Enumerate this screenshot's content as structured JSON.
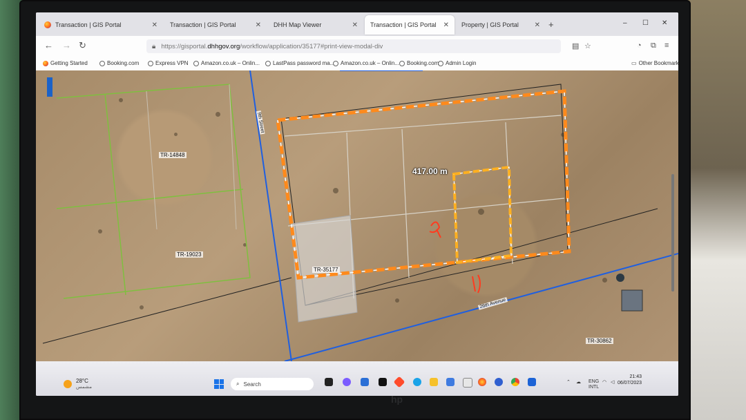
{
  "tabs": [
    {
      "title": "Transaction | GIS Portal",
      "active": false
    },
    {
      "title": "Transaction | GIS Portal",
      "active": false
    },
    {
      "title": "DHH Map Viewer",
      "active": false
    },
    {
      "title": "Transaction | GIS Portal",
      "active": true
    },
    {
      "title": "Property | GIS Portal",
      "active": false
    }
  ],
  "newtab": "+",
  "window_controls": [
    "–",
    "☐",
    "✕"
  ],
  "nav": {
    "back": "←",
    "forward": "→",
    "reload": "↻",
    "url_prefix": "https://gisportal.",
    "url_domain": "dhhgov.org",
    "url_suffix": "/workflow/application/35177#print-view-modal-div"
  },
  "bookmarks": [
    {
      "label": "Getting Started",
      "icon": "firefox-icon"
    },
    {
      "label": "Booking.com",
      "icon": "globe-icon"
    },
    {
      "label": "Express VPN",
      "icon": "globe-icon"
    },
    {
      "label": "Amazon.co.uk – Onlin...",
      "icon": "globe-icon"
    },
    {
      "label": "LastPass password ma...",
      "icon": "globe-icon"
    },
    {
      "label": "Amazon.co.uk – Onlin...",
      "icon": "globe-icon"
    },
    {
      "label": "Booking.com",
      "icon": "globe-icon"
    },
    {
      "label": "Admin Login",
      "icon": "globe-icon"
    }
  ],
  "other_bookmarks": "Other Bookmarks",
  "map": {
    "parcels": [
      "TR-14848",
      "TR-19023",
      "TR-35177",
      "TR-30862"
    ],
    "measurement": "417.00 m",
    "road": "26th Avenue",
    "street": "9th Street",
    "colors": {
      "parcel_outline": "#7fbf3f",
      "road": "#1f5fe0",
      "highlight": "#ff8a1c",
      "inner": "#ffb020"
    }
  },
  "taskbar": {
    "weather_temp": "28°C",
    "weather_sub": "مشمس",
    "search_placeholder": "Search",
    "lang_top": "ENG",
    "lang_bottom": "INTL",
    "time": "21:43",
    "date": "06/07/2023"
  }
}
